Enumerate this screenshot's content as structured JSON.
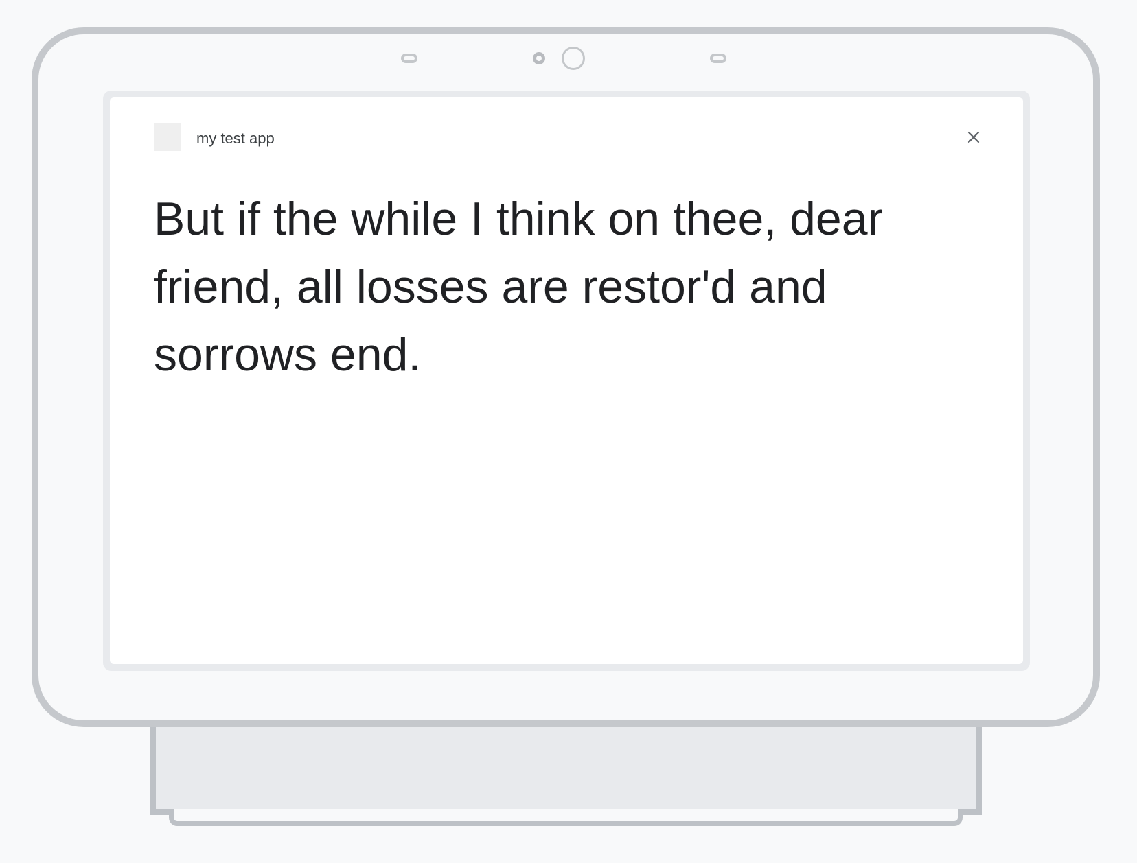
{
  "app": {
    "name": "my test app",
    "icon": "app-icon-placeholder"
  },
  "header": {
    "close_icon": "close-icon"
  },
  "content": {
    "text": "But if the while I think on thee, dear friend, all losses are restor'd and sorrows end."
  },
  "colors": {
    "background": "#f8f9fa",
    "device_outline": "#c5c8cc",
    "screen_bezel": "#e8eaed",
    "screen": "#ffffff",
    "text": "#202124",
    "app_name": "#3c4043"
  }
}
